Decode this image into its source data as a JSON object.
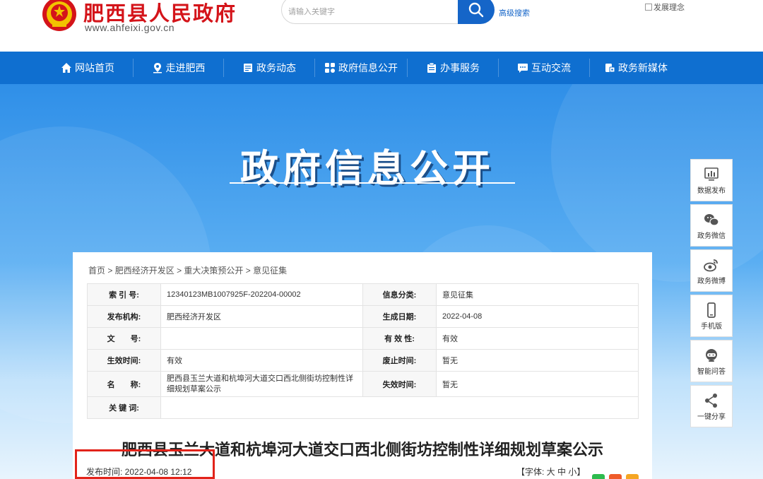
{
  "header": {
    "title": "肥西县人民政府",
    "url": "www.ahfeixi.gov.cn",
    "search_placeholder": "请输入关键字",
    "advanced_search": "高级搜索",
    "top_right_alt": "发展理念"
  },
  "nav": {
    "items": [
      {
        "label": "网站首页",
        "icon": "home-icon"
      },
      {
        "label": "走进肥西",
        "icon": "location-icon"
      },
      {
        "label": "政务动态",
        "icon": "news-icon"
      },
      {
        "label": "政府信息公开",
        "icon": "grid-icon"
      },
      {
        "label": "办事服务",
        "icon": "clipboard-icon"
      },
      {
        "label": "互动交流",
        "icon": "chat-icon"
      },
      {
        "label": "政务新媒体",
        "icon": "media-icon"
      }
    ]
  },
  "banner": {
    "title": "政府信息公开"
  },
  "breadcrumb": [
    "首页",
    "肥西经济开发区",
    "重大决策预公开",
    "意见征集"
  ],
  "meta": {
    "index_label": "索 引 号:",
    "index_value": "12340123MB1007925F-202204-00002",
    "category_label": "信息分类:",
    "category_value": "意见征集",
    "publisher_label": "发布机构:",
    "publisher_value": "肥西经济开发区",
    "gen_date_label": "生成日期:",
    "gen_date_value": "2022-04-08",
    "doc_no_label": "文　　号:",
    "doc_no_value": "",
    "validity_label": "有 效 性:",
    "validity_value": "有效",
    "effective_label": "生效时间:",
    "effective_value": "有效",
    "abolish_label": "废止时间:",
    "abolish_value": "暂无",
    "name_label": "名　　称:",
    "name_value": "肥西县玉兰大道和杭埠河大道交口西北侧街坊控制性详细规划草案公示",
    "expire_label": "失效时间:",
    "expire_value": "暂无",
    "keywords_label": "关 键 词:",
    "keywords_value": ""
  },
  "article": {
    "title": "肥西县玉兰大道和杭埠河大道交口西北侧街坊控制性详细规划草案公示",
    "pub_time": "发布时间:   2022-04-08 12:12",
    "font_size": "【字体:  大  中  小】"
  },
  "sidebar": {
    "items": [
      {
        "label": "数据发布",
        "icon": "chart-icon"
      },
      {
        "label": "政务微信",
        "icon": "wechat-icon"
      },
      {
        "label": "政务微博",
        "icon": "weibo-icon"
      },
      {
        "label": "手机版",
        "icon": "mobile-icon"
      },
      {
        "label": "智能问答",
        "icon": "robot-icon"
      },
      {
        "label": "一键分享",
        "icon": "share-icon"
      }
    ]
  },
  "colors": {
    "brand_red": "#d4141a",
    "nav_blue": "#0f6fd0",
    "highlight_red": "#e2231a"
  }
}
